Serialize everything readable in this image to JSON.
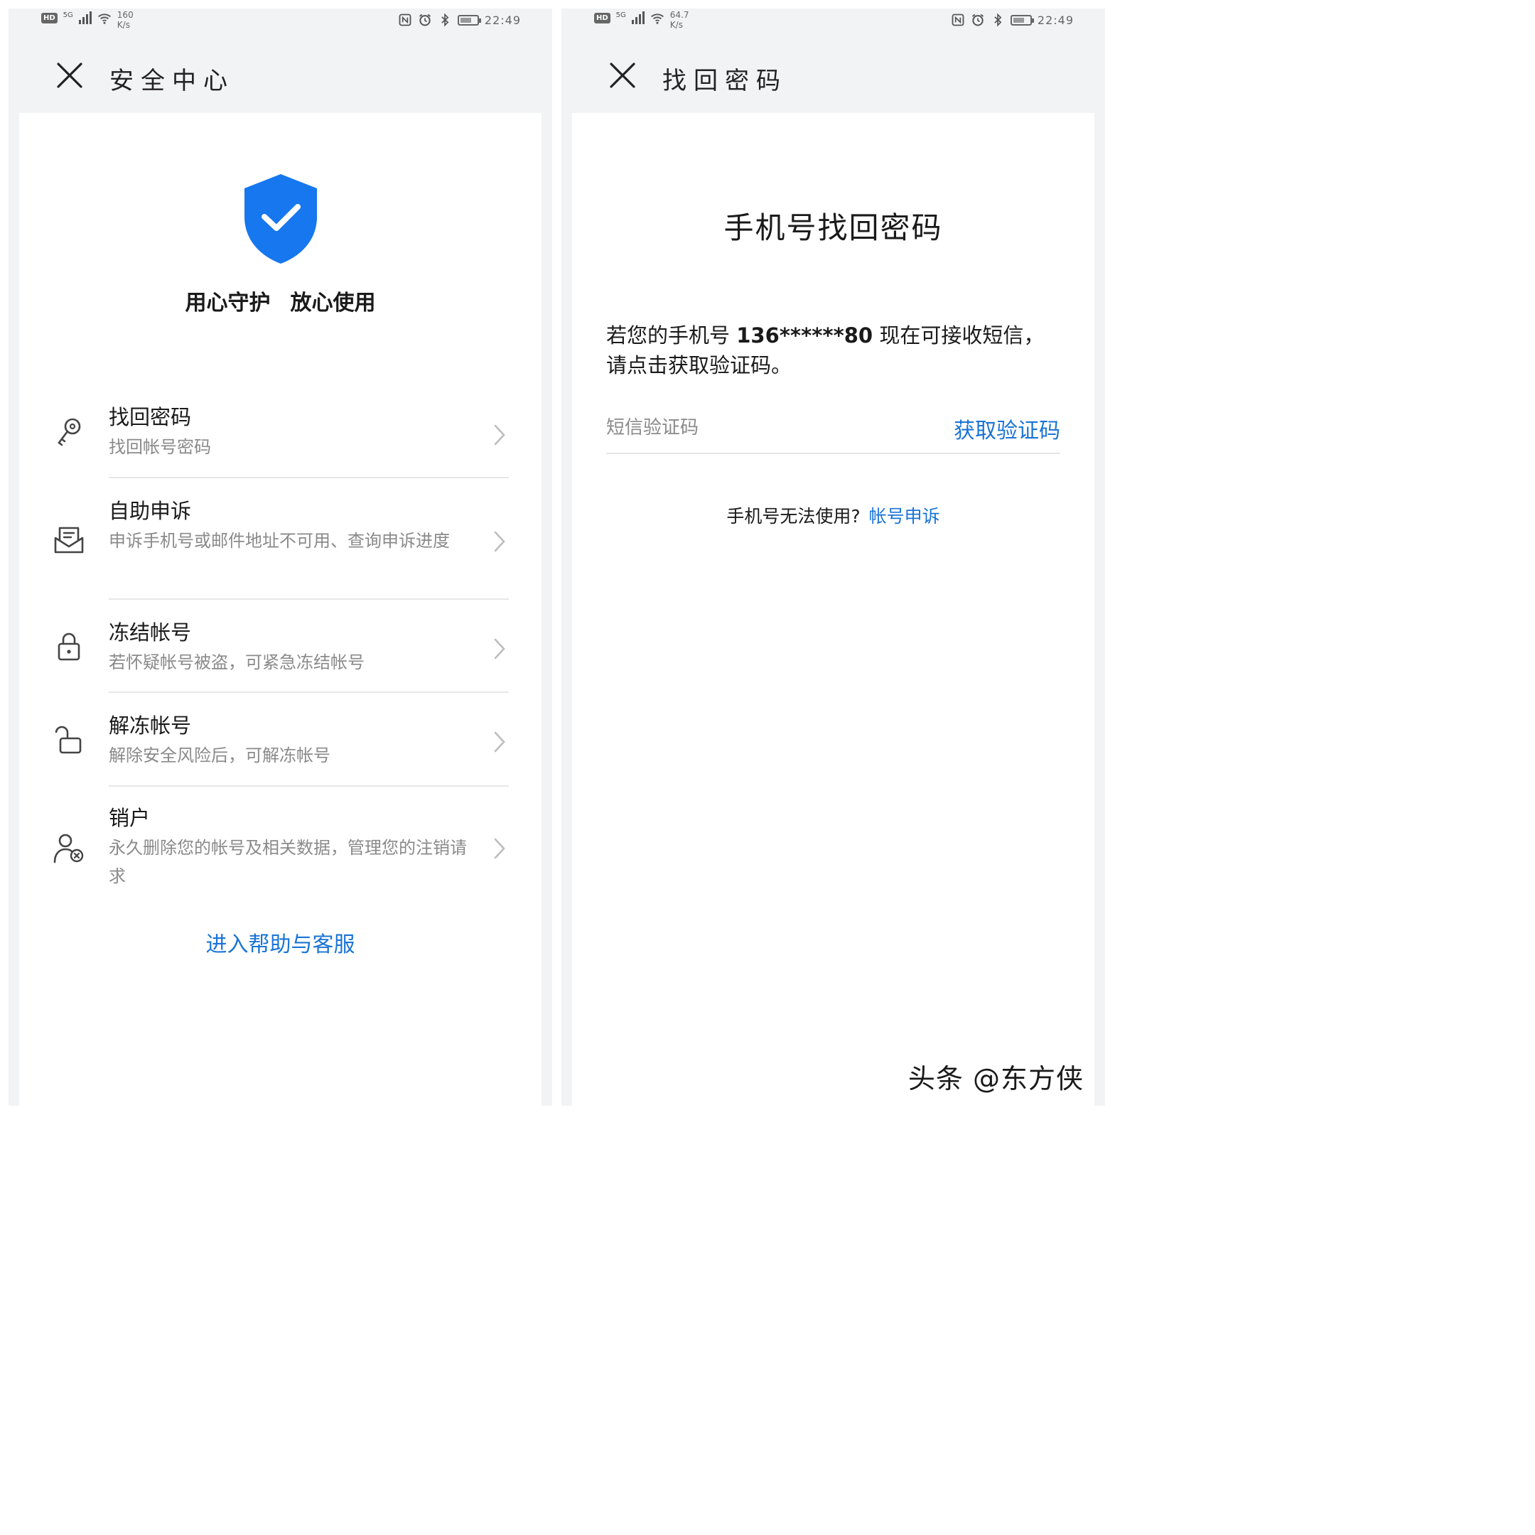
{
  "colors": {
    "accent": "#1a74d6",
    "shield": "#1677ee",
    "subtext": "#8a8a8a",
    "background": "#f1f3f5"
  },
  "left": {
    "status": {
      "hd": "HD",
      "net": "5G",
      "speed_value": "160",
      "speed_unit": "K/s",
      "time": "22:49"
    },
    "title": "安全中心",
    "slogan_a": "用心守护",
    "slogan_b": "放心使用",
    "menu": [
      {
        "icon": "key-icon",
        "title": "找回密码",
        "subtitle": "找回帐号密码"
      },
      {
        "icon": "mail-icon",
        "title": "自助申诉",
        "subtitle": "申诉手机号或邮件地址不可用、查询申诉进度"
      },
      {
        "icon": "lock-icon",
        "title": "冻结帐号",
        "subtitle": "若怀疑帐号被盗，可紧急冻结帐号"
      },
      {
        "icon": "unlock-icon",
        "title": "解冻帐号",
        "subtitle": "解除安全风险后，可解冻帐号"
      },
      {
        "icon": "user-remove-icon",
        "title": "销户",
        "subtitle": "永久删除您的帐号及相关数据，管理您的注销请求"
      }
    ],
    "help_link": "进入帮助与客服"
  },
  "right": {
    "status": {
      "hd": "HD",
      "net": "5G",
      "speed_value": "64.7",
      "speed_unit": "K/s",
      "time": "22:49"
    },
    "title": "找回密码",
    "heading": "手机号找回密码",
    "desc_prefix": "若您的手机号 ",
    "phone": "136******80",
    "desc_suffix": " 现在可接收短信，请点击获取验证码。",
    "sms_placeholder": "短信验证码",
    "get_code": "获取验证码",
    "cant_use": "手机号无法使用?",
    "appeal": "帐号申诉"
  },
  "watermark": "头条 @东方侠"
}
